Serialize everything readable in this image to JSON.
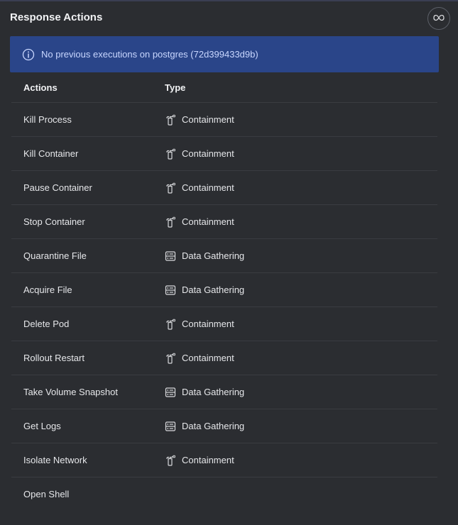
{
  "header": {
    "title": "Response Actions",
    "icon_button": "infinity-icon"
  },
  "banner": {
    "icon": "info-icon",
    "message": "No previous executions on postgres (72d399433d9b)",
    "color": "#2a4589"
  },
  "table": {
    "columns": [
      "Actions",
      "Type"
    ],
    "rows": [
      {
        "action": "Kill Process",
        "type": "Containment",
        "icon": "fire-extinguisher-icon"
      },
      {
        "action": "Kill Container",
        "type": "Containment",
        "icon": "fire-extinguisher-icon"
      },
      {
        "action": "Pause Container",
        "type": "Containment",
        "icon": "fire-extinguisher-icon"
      },
      {
        "action": "Stop Container",
        "type": "Containment",
        "icon": "fire-extinguisher-icon"
      },
      {
        "action": "Quarantine File",
        "type": "Data Gathering",
        "icon": "data-gathering-icon"
      },
      {
        "action": "Acquire File",
        "type": "Data Gathering",
        "icon": "data-gathering-icon"
      },
      {
        "action": "Delete Pod",
        "type": "Containment",
        "icon": "fire-extinguisher-icon"
      },
      {
        "action": "Rollout Restart",
        "type": "Containment",
        "icon": "fire-extinguisher-icon"
      },
      {
        "action": "Take Volume Snapshot",
        "type": "Data Gathering",
        "icon": "data-gathering-icon"
      },
      {
        "action": "Get Logs",
        "type": "Data Gathering",
        "icon": "data-gathering-icon"
      },
      {
        "action": "Isolate Network",
        "type": "Containment",
        "icon": "fire-extinguisher-icon"
      },
      {
        "action": "Open Shell",
        "type": "",
        "icon": ""
      }
    ]
  }
}
